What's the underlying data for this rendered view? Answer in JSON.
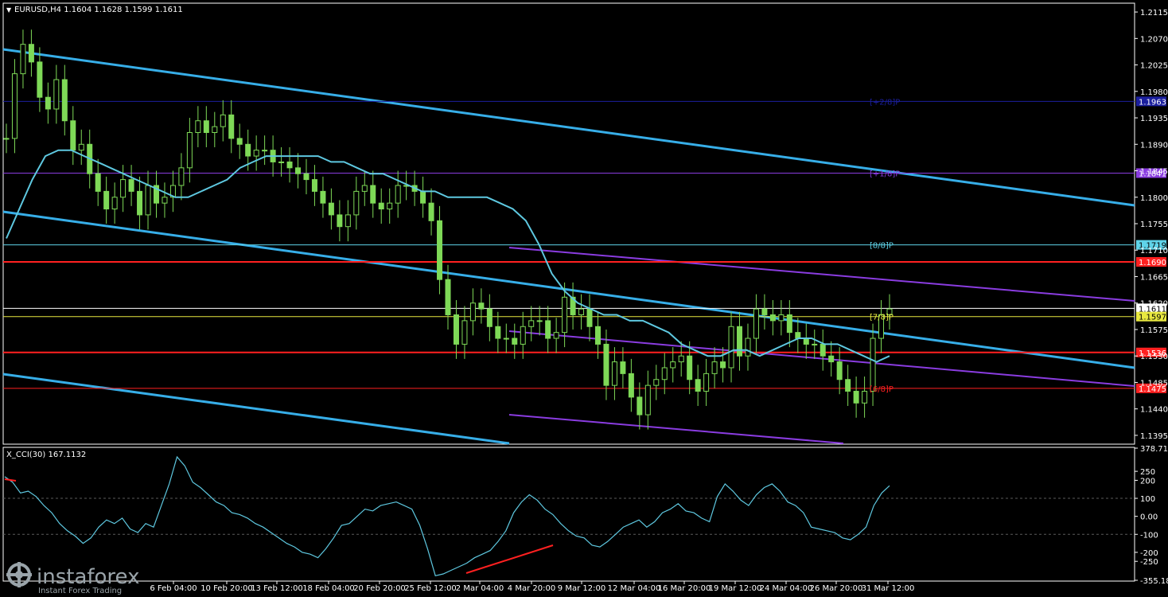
{
  "header": {
    "symbol_label": "EURUSD,H4  1.1604  1.1628  1.1599  1.1611",
    "indicator_label": "X_CCI(30) 167.1132"
  },
  "brand": {
    "name": "instaforex",
    "tagline": "Instant Forex Trading",
    "icon": "instaforex-logo-icon"
  },
  "chart_data": [
    {
      "type": "candlestick",
      "title": "EURUSD,H4",
      "ohlc_last": {
        "open": 1.1604,
        "high": 1.1628,
        "low": 1.1599,
        "close": 1.1611
      },
      "ylim": [
        1.138,
        1.213
      ],
      "y_ticks": [
        "1.2115",
        "1.2070",
        "1.2025",
        "1.1980",
        "1.1935",
        "1.1890",
        "1.1845",
        "1.1800",
        "1.1755",
        "1.1710",
        "1.1665",
        "1.1620",
        "1.1575",
        "1.1530",
        "1.1485",
        "1.1440",
        "1.1395"
      ],
      "x_ticks": [
        "6 Feb 04:00",
        "10 Feb 20:00",
        "13 Feb 12:00",
        "18 Feb 04:00",
        "20 Feb 20:00",
        "25 Feb 12:00",
        "2 Mar 04:00",
        "4 Mar 20:00",
        "9 Mar 12:00",
        "12 Mar 04:00",
        "16 Mar 20:00",
        "19 Mar 12:00",
        "24 Mar 04:00",
        "26 Mar 20:00",
        "31 Mar 12:00"
      ],
      "close_series": [
        1.19,
        1.201,
        1.206,
        1.203,
        1.197,
        1.195,
        1.2,
        1.193,
        1.188,
        1.189,
        1.184,
        1.181,
        1.178,
        1.18,
        1.183,
        1.181,
        1.177,
        1.182,
        1.179,
        1.18,
        1.182,
        1.185,
        1.191,
        1.193,
        1.191,
        1.192,
        1.194,
        1.19,
        1.189,
        1.187,
        1.188,
        1.188,
        1.186,
        1.186,
        1.185,
        1.184,
        1.183,
        1.181,
        1.179,
        1.177,
        1.175,
        1.177,
        1.181,
        1.182,
        1.179,
        1.178,
        1.179,
        1.182,
        1.182,
        1.181,
        1.179,
        1.176,
        1.166,
        1.16,
        1.155,
        1.159,
        1.162,
        1.161,
        1.158,
        1.156,
        1.156,
        1.155,
        1.158,
        1.159,
        1.159,
        1.156,
        1.157,
        1.163,
        1.16,
        1.161,
        1.158,
        1.155,
        1.148,
        1.152,
        1.15,
        1.146,
        1.143,
        1.148,
        1.149,
        1.151,
        1.152,
        1.153,
        1.149,
        1.147,
        1.15,
        1.152,
        1.151,
        1.158,
        1.153,
        1.156,
        1.161,
        1.16,
        1.159,
        1.16,
        1.157,
        1.156,
        1.155,
        1.155,
        1.153,
        1.152,
        1.149,
        1.147,
        1.145,
        1.147,
        1.156,
        1.16,
        1.161
      ],
      "moving_average": {
        "name": "",
        "values": [
          1.173,
          1.178,
          1.183,
          1.187,
          1.188,
          1.188,
          1.187,
          1.186,
          1.185,
          1.184,
          1.183,
          1.182,
          1.181,
          1.18,
          1.18,
          1.181,
          1.182,
          1.183,
          1.185,
          1.186,
          1.187,
          1.187,
          1.187,
          1.187,
          1.187,
          1.186,
          1.186,
          1.185,
          1.184,
          1.184,
          1.183,
          1.182,
          1.181,
          1.181,
          1.18,
          1.18,
          1.18,
          1.18,
          1.179,
          1.178,
          1.176,
          1.172,
          1.167,
          1.164,
          1.162,
          1.161,
          1.16,
          1.16,
          1.159,
          1.159,
          1.158,
          1.157,
          1.155,
          1.154,
          1.153,
          1.153,
          1.154,
          1.154,
          1.153,
          1.154,
          1.155,
          1.156,
          1.156,
          1.155,
          1.155,
          1.154,
          1.153,
          1.152,
          1.153
        ]
      },
      "levels": [
        {
          "value": 1.1963,
          "label": "1.1963",
          "murrey": "[+2/8]P",
          "color": "#1b1f9e"
        },
        {
          "value": 1.1841,
          "label": "1.1841",
          "murrey": "[+1/8]P",
          "color": "#8a3ce0"
        },
        {
          "value": 1.1719,
          "label": "1.1719",
          "murrey": "[8/8]P",
          "color": "#5fd3e8"
        },
        {
          "value": 1.169,
          "label": "1.1690",
          "murrey": "",
          "color": "#ff2020"
        },
        {
          "value": 1.1611,
          "label": "1.1611",
          "murrey": "",
          "color": "#ffffff"
        },
        {
          "value": 1.1597,
          "label": "1.1597",
          "murrey": "[7/8]P",
          "color": "#e8e840"
        },
        {
          "value": 1.1536,
          "label": "1.1536",
          "murrey": "",
          "color": "#ff2020"
        },
        {
          "value": 1.1475,
          "label": "1.1475",
          "murrey": "[6/8]P",
          "color": "#ff2020"
        }
      ]
    },
    {
      "type": "line",
      "title": "X_CCI(30) 167.1132",
      "ylim": [
        -355.1891,
        378.7116
      ],
      "y_ticks": [
        "378.7116",
        "250",
        "200",
        "100",
        "0.00",
        "-100",
        "-200",
        "-250",
        "-355.1891"
      ],
      "values": [
        220,
        190,
        130,
        140,
        110,
        60,
        20,
        -40,
        -80,
        -110,
        -150,
        -120,
        -60,
        -20,
        -40,
        -10,
        -70,
        -90,
        -40,
        -60,
        60,
        180,
        330,
        280,
        190,
        160,
        120,
        80,
        60,
        20,
        10,
        -10,
        -40,
        -60,
        -90,
        -120,
        -150,
        -170,
        -200,
        -210,
        -230,
        -180,
        -120,
        -50,
        -40,
        0,
        40,
        30,
        60,
        70,
        80,
        60,
        40,
        -50,
        -180,
        -330,
        -320,
        -300,
        -280,
        -260,
        -230,
        -210,
        -190,
        -140,
        -80,
        20,
        80,
        120,
        90,
        40,
        10,
        -40,
        -80,
        -110,
        -120,
        -160,
        -170,
        -140,
        -100,
        -60,
        -40,
        -20,
        -60,
        -30,
        20,
        40,
        70,
        30,
        20,
        -10,
        -30,
        110,
        180,
        140,
        90,
        60,
        120,
        160,
        180,
        140,
        80,
        60,
        20,
        -60,
        -70,
        -80,
        -90,
        -120,
        -130,
        -100,
        -60,
        60,
        130,
        170
      ]
    }
  ]
}
